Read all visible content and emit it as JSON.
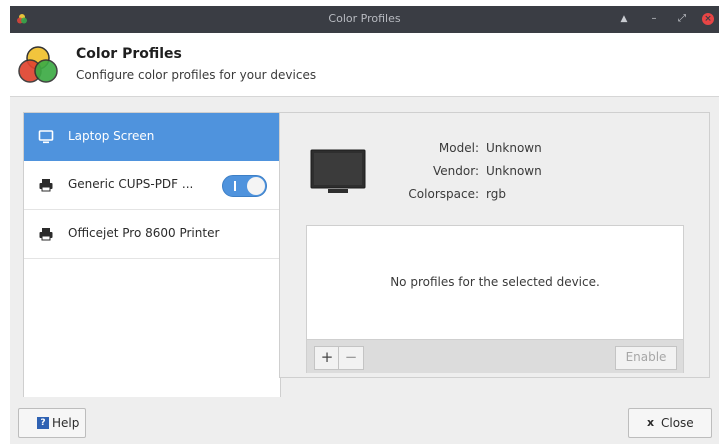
{
  "window": {
    "title": "Color Profiles"
  },
  "header": {
    "title": "Color Profiles",
    "subtitle": "Configure color profiles for your devices"
  },
  "devices": [
    {
      "label": "Laptop Screen",
      "icon": "monitor-icon",
      "selected": true
    },
    {
      "label": "Generic CUPS-PDF ...",
      "icon": "printer-icon",
      "selected": false,
      "toggle_on": true
    },
    {
      "label": "Officejet Pro 8600 Printer",
      "icon": "printer-icon",
      "selected": false
    }
  ],
  "details": {
    "model_label": "Model:",
    "model": "Unknown",
    "vendor_label": "Vendor:",
    "vendor": "Unknown",
    "colorspace_label": "Colorspace:",
    "colorspace": "rgb"
  },
  "profiles": {
    "empty_text": "No profiles for the selected device.",
    "add_label": "+",
    "remove_label": "−",
    "enable_label": "Enable"
  },
  "footer": {
    "help_label": "Help",
    "help_icon_glyph": "?",
    "close_label": "Close",
    "close_icon_glyph": "x"
  },
  "colors": {
    "titlebar": "#3a3d44",
    "accent": "#4f93dd",
    "close_button": "#e84545"
  }
}
